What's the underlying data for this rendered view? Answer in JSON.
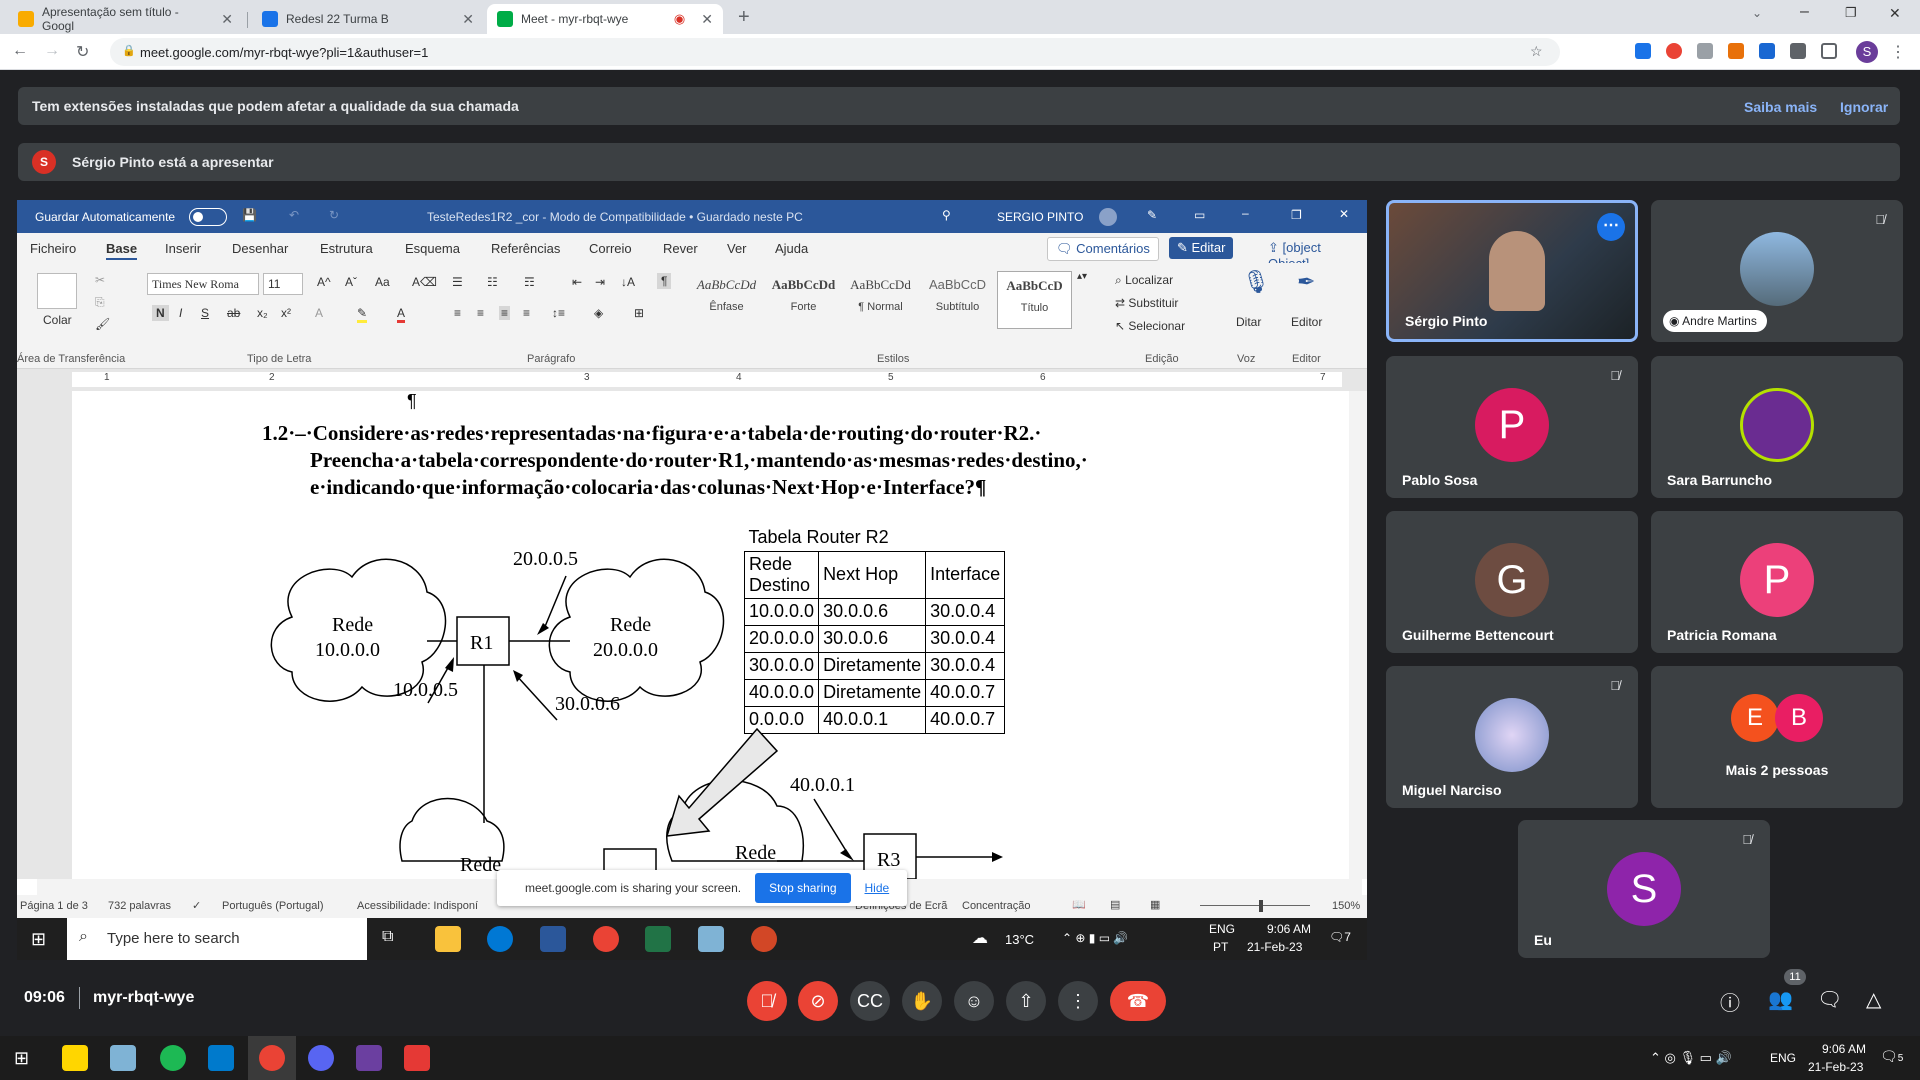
{
  "tabs": [
    {
      "title": "Apresentação sem título - Googl",
      "color": "#f9ab00"
    },
    {
      "title": "Redesl 22 Turma B",
      "color": "#1a73e8"
    },
    {
      "title": "Meet - myr-rbqt-wye",
      "color": "#00ac47"
    }
  ],
  "url": "meet.google.com/myr-rbqt-wye?pli=1&authuser=1",
  "profile_initial": "S",
  "ext_banner": {
    "text": "Tem extensões instaladas que podem afetar a qualidade da sua chamada",
    "learn": "Saiba mais",
    "ignore": "Ignorar"
  },
  "present_banner": {
    "initial": "S",
    "text": "Sérgio Pinto está a apresentar"
  },
  "word": {
    "autosave": "Guardar Automaticamente",
    "title": "TesteRedes1R2 _cor  -  Modo de Compatibilidade  •  Guardado neste PC",
    "user": "SERGIO PINTO",
    "menu": [
      "Ficheiro",
      "Base",
      "Inserir",
      "Desenhar",
      "Estrutura",
      "Esquema",
      "Referências",
      "Correio",
      "Rever",
      "Ver",
      "Ajuda"
    ],
    "comments": "Comentários",
    "edit": "Editar",
    "share": {
      "text": "meet.google.com is sharing your screen.",
      "stop": "Stop sharing",
      "hide": "Hide"
    },
    "paste": "Colar",
    "font": "Times New Roma",
    "size": "11",
    "styles": [
      {
        "preview": "AaBbCcDd",
        "name": "Ênfase"
      },
      {
        "preview": "AaBbCcDd",
        "name": "Forte"
      },
      {
        "preview": "AaBbCcDd",
        "name": "¶ Normal"
      },
      {
        "preview": "AaBbCcD",
        "name": "Subtítulo"
      },
      {
        "preview": "AaBbCcD",
        "name": "Título"
      }
    ],
    "find": "Localizar",
    "replace": "Substituir",
    "select": "Selecionar",
    "dictate": "Ditar",
    "editor": "Editor",
    "groups": [
      "Área de Transferência",
      "Tipo de Letra",
      "Parágrafo",
      "Estilos",
      "Edição",
      "Voz",
      "Editor"
    ],
    "ruler_nums": [
      "1",
      "2",
      "3",
      "4",
      "5",
      "6",
      "7"
    ],
    "pilcrow": "¶",
    "question": [
      "1.2·–·Considere·as·redes·representadas·na·figura·e·a·tabela·de·routing·do·router·R2.·",
      "Preencha·a·tabela·correspondente·do·router·R1,·mantendo·as·mesmas·redes·destino,·",
      "e·indicando·que·informação·colocaria·das·colunas·Next·Hop·e·Interface?¶"
    ],
    "table": {
      "caption": "Tabela Router R2",
      "headers": [
        "Rede Destino",
        "Next Hop",
        "Interface"
      ],
      "rows": [
        [
          "10.0.0.0",
          "30.0.0.6",
          "30.0.0.4"
        ],
        [
          "20.0.0.0",
          "30.0.0.6",
          "30.0.0.4"
        ],
        [
          "30.0.0.0",
          "Diretamente",
          "30.0.0.4"
        ],
        [
          "40.0.0.0",
          "Diretamente",
          "40.0.0.7"
        ],
        [
          "0.0.0.0",
          "40.0.0.1",
          "40.0.0.7"
        ]
      ]
    },
    "diagram": {
      "r1": "R1",
      "r3": "R3",
      "rede": "Rede",
      "net1": "10.0.0.0",
      "net2": "20.0.0.0",
      "ip_a": "20.0.0.5",
      "ip_b": "10.0.0.5",
      "ip_c": "30.0.0.6",
      "ip_d": "40.0.0.1",
      "partial": "Rede"
    },
    "status": {
      "page": "Página 1 de 3",
      "words": "732 palavras",
      "lang": "Português (Portugal)",
      "access": "Acessibilidade: Indisponí",
      "focus": "Concentração",
      "display": "Definições de Ecrã",
      "zoom": "150%"
    }
  },
  "taskbar1": {
    "search": "Type here to search",
    "temp": "13°C",
    "lang1": "ENG",
    "lang2": "PT",
    "time": "9:06 AM",
    "date": "21-Feb-23",
    "notif": "7"
  },
  "participants": [
    {
      "name": "Sérgio Pinto",
      "initial": "",
      "color": "#6b4a3a"
    },
    {
      "name": "Andre Martins",
      "initial": "",
      "color": "#4a6f8a"
    },
    {
      "name": "Pablo Sosa",
      "initial": "P",
      "color": "#d81b60"
    },
    {
      "name": "Sara Barruncho",
      "initial": "",
      "color": "#6a2c91"
    },
    {
      "name": "Guilherme Bettencourt",
      "initial": "G",
      "color": "#6d4c41"
    },
    {
      "name": "Patricia Romana",
      "initial": "P",
      "color": "#ec407a"
    },
    {
      "name": "Miguel Narciso",
      "initial": "",
      "color": "#9ab3d8"
    },
    {
      "name": "Mais 2 pessoas",
      "initial": "",
      "color": "#3c4043"
    },
    {
      "name": "Eu",
      "initial": "S",
      "color": "#8e24aa"
    }
  ],
  "more": {
    "a": "E",
    "b": "B",
    "a_color": "#f4511e",
    "b_color": "#e91e63"
  },
  "meet": {
    "time": "09:06",
    "code": "myr-rbqt-wye",
    "people_count": "11"
  },
  "wintb": {
    "lang": "ENG",
    "time": "9:06 AM",
    "date": "21-Feb-23",
    "notif": "5"
  }
}
